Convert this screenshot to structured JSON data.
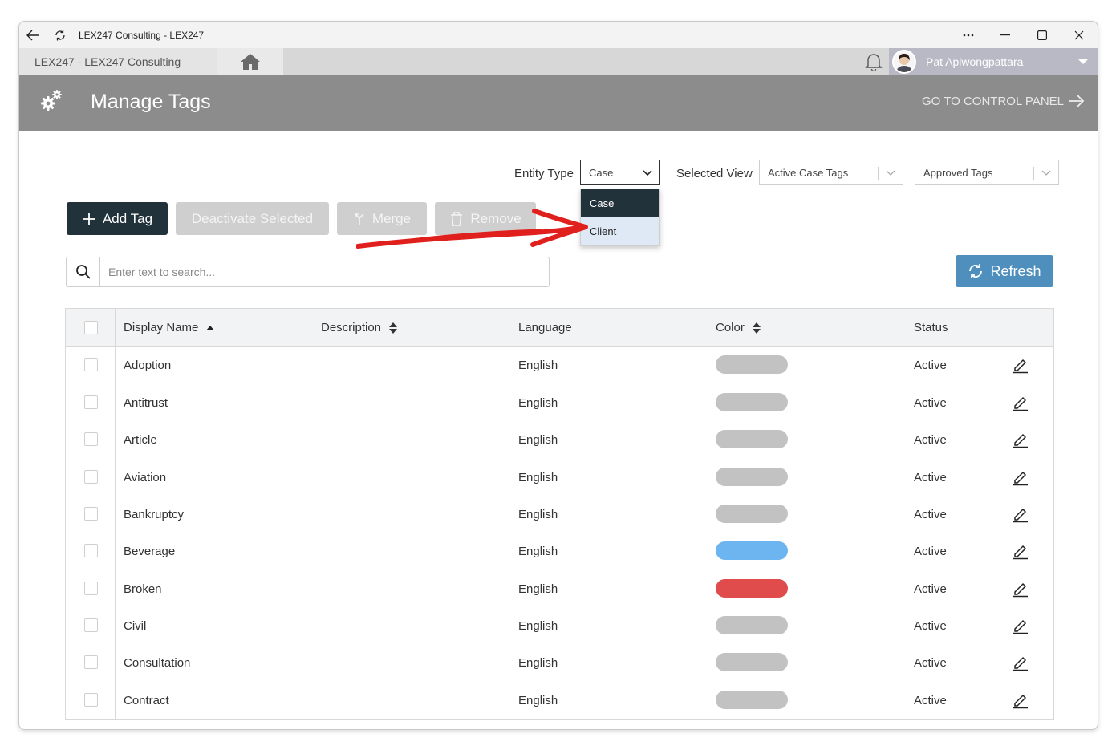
{
  "window": {
    "title": "LEX247 Consulting - LEX247"
  },
  "nav": {
    "breadcrumb": "LEX247  -  LEX247 Consulting",
    "user_name": "Pat Apiwongpattara"
  },
  "header": {
    "title": "Manage Tags",
    "control_panel": "GO TO CONTROL PANEL"
  },
  "filters": {
    "entity_type_label": "Entity Type",
    "entity_type_value": "Case",
    "entity_type_options": [
      "Case",
      "Client"
    ],
    "selected_view_label": "Selected View",
    "selected_view_value": "Active Case Tags",
    "approval_value": "Approved Tags"
  },
  "actions": {
    "add_tag": "Add Tag",
    "deactivate": "Deactivate Selected",
    "merge": "Merge",
    "remove": "Remove",
    "refresh": "Refresh"
  },
  "search": {
    "placeholder": "Enter text to search..."
  },
  "table": {
    "columns": [
      "Display Name",
      "Description",
      "Language",
      "Color",
      "Status"
    ],
    "rows": [
      {
        "name": "Adoption",
        "description": "",
        "language": "English",
        "color": "#c2c2c2",
        "status": "Active"
      },
      {
        "name": "Antitrust",
        "description": "",
        "language": "English",
        "color": "#c2c2c2",
        "status": "Active"
      },
      {
        "name": "Article",
        "description": "",
        "language": "English",
        "color": "#c2c2c2",
        "status": "Active"
      },
      {
        "name": "Aviation",
        "description": "",
        "language": "English",
        "color": "#c2c2c2",
        "status": "Active"
      },
      {
        "name": "Bankruptcy",
        "description": "",
        "language": "English",
        "color": "#c2c2c2",
        "status": "Active"
      },
      {
        "name": "Beverage",
        "description": "",
        "language": "English",
        "color": "#6db5f0",
        "status": "Active"
      },
      {
        "name": "Broken",
        "description": "",
        "language": "English",
        "color": "#e04b4b",
        "status": "Active"
      },
      {
        "name": "Civil",
        "description": "",
        "language": "English",
        "color": "#c2c2c2",
        "status": "Active"
      },
      {
        "name": "Consultation",
        "description": "",
        "language": "English",
        "color": "#c2c2c2",
        "status": "Active"
      },
      {
        "name": "Contract",
        "description": "",
        "language": "English",
        "color": "#c2c2c2",
        "status": "Active"
      }
    ]
  },
  "colors": {
    "accent_dark": "#22323a",
    "refresh_blue": "#4f8fbe",
    "annotation_red": "#e0201c"
  }
}
